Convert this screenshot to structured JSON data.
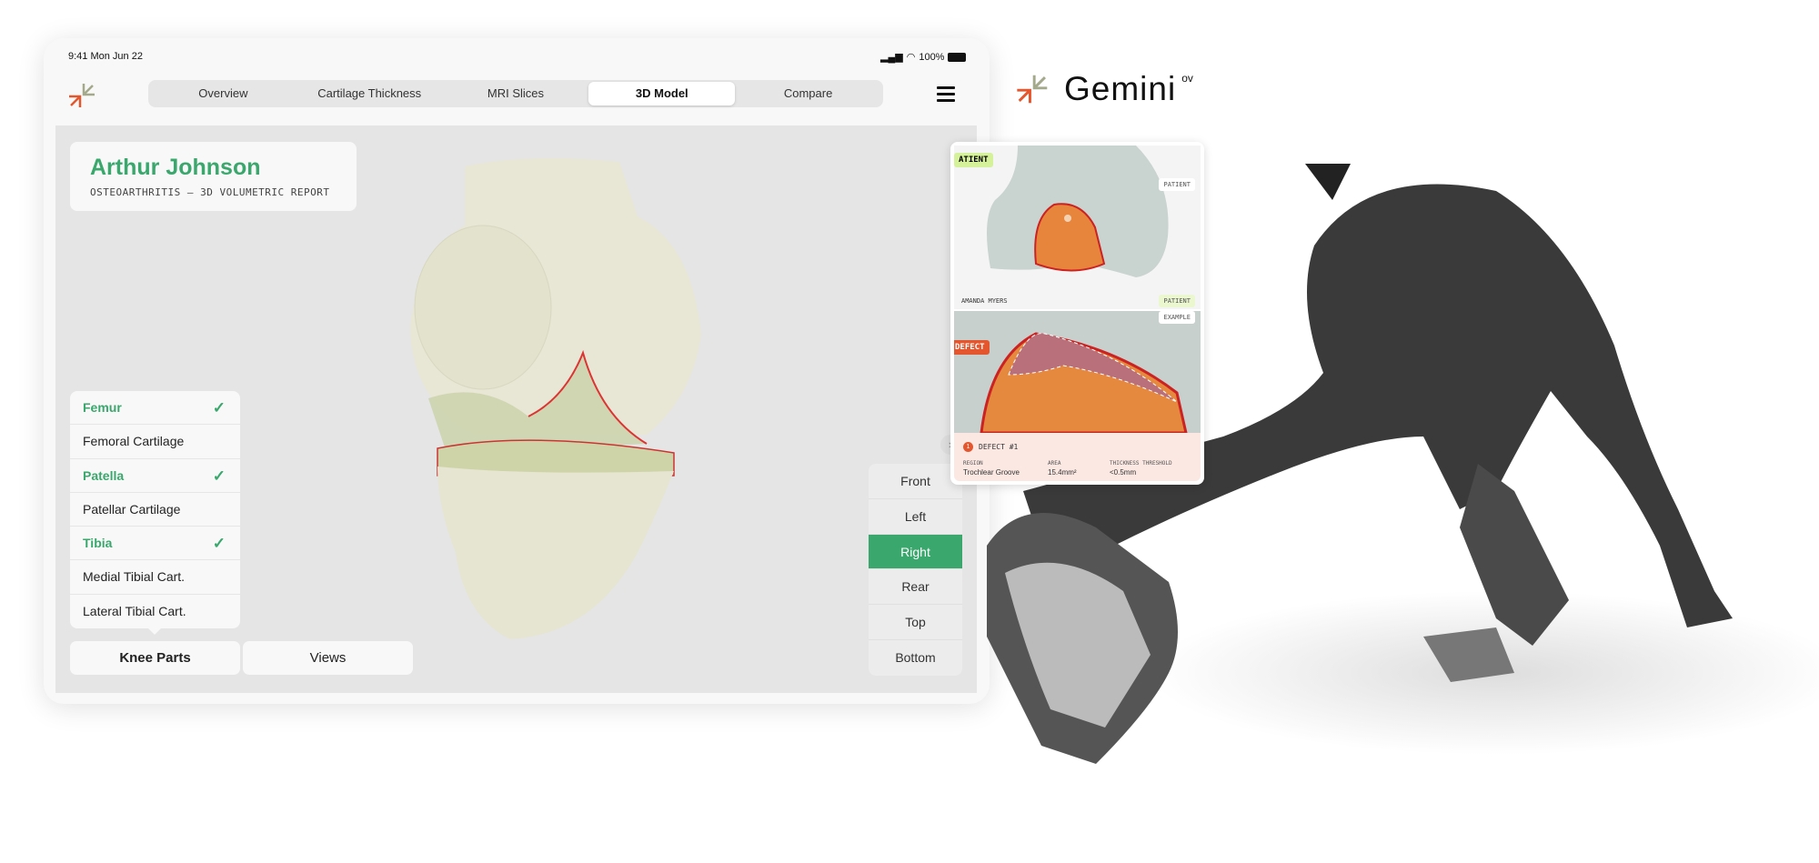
{
  "status_bar": {
    "time": "9:41  Mon Jun 22",
    "battery": "100%"
  },
  "nav": {
    "tabs": [
      {
        "label": "Overview"
      },
      {
        "label": "Cartilage Thickness"
      },
      {
        "label": "MRI Slices"
      },
      {
        "label": "3D Model",
        "active": true
      },
      {
        "label": "Compare"
      }
    ]
  },
  "patient": {
    "name": "Arthur Johnson",
    "report": "OSTEOARTHRITIS – 3D VOLUMETRIC REPORT"
  },
  "knee_parts": [
    {
      "label": "Femur",
      "checked": true
    },
    {
      "label": "Femoral Cartilage",
      "checked": false
    },
    {
      "label": "Patella",
      "checked": true
    },
    {
      "label": "Patellar Cartilage",
      "checked": false
    },
    {
      "label": "Tibia",
      "checked": true
    },
    {
      "label": "Medial Tibial Cart.",
      "checked": false
    },
    {
      "label": "Lateral Tibial Cart.",
      "checked": false
    }
  ],
  "check_glyph": "✓",
  "bottom_buttons": {
    "knee_parts": "Knee Parts",
    "views": "Views"
  },
  "views": [
    {
      "label": "Front"
    },
    {
      "label": "Left"
    },
    {
      "label": "Right",
      "active": true
    },
    {
      "label": "Rear"
    },
    {
      "label": "Top"
    },
    {
      "label": "Bottom"
    }
  ],
  "defect_card": {
    "tag_patient_top": "ATIENT",
    "label_patient_right": "PATIENT",
    "patient_name": "AMANDA MYERS",
    "tag_patient": "PATIENT",
    "tag_example": "EXAMPLE",
    "tag_defect": "DEFECT",
    "marker": "1",
    "title": "DEFECT #1",
    "region_label": "REGION",
    "region_value": "Trochlear Groove",
    "area_label": "AREA",
    "area_value": "15.4mm²",
    "threshold_label": "THICKNESS THRESHOLD",
    "threshold_value": "<0.5mm"
  },
  "brand": {
    "name": "Gemini",
    "suffix": "ov"
  },
  "colors": {
    "accent": "#3aa76d",
    "logo_orange": "#e4572e",
    "logo_olive": "#a3a98a"
  }
}
